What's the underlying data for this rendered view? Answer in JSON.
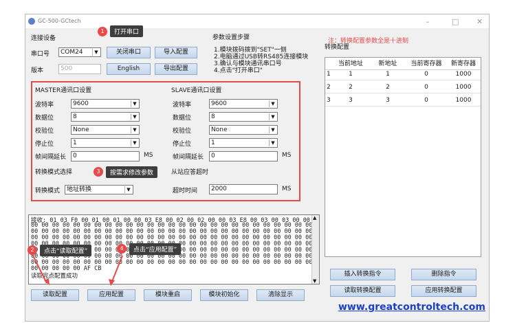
{
  "window": {
    "title": "GC-500-GCtech",
    "min": "–",
    "max": "□",
    "close": "✕"
  },
  "connect": {
    "section_label": "连接设备",
    "port_label": "串口号",
    "port_value": "COM24",
    "close_port": "关闭串口",
    "import_cfg": "导入配置",
    "version_label": "版本",
    "version_value": "500",
    "language": "English",
    "export_cfg": "导出配置"
  },
  "steps": {
    "title": "参数设置步骤",
    "items": [
      "1.模块拨码拨到\"SET\"一侧",
      "2.电脑通过USB转RS485连接模块",
      "3.确认与模块通讯串口号",
      "4.点击\"打开串口\""
    ]
  },
  "note": {
    "text": "注：转换配置参数全是十进制",
    "color": "#e74a4a"
  },
  "master": {
    "title": "MASTER通讯口设置",
    "baud_label": "波特率",
    "baud": "9600",
    "data_label": "数据位",
    "data": "8",
    "parity_label": "校验位",
    "parity": "None",
    "stop_label": "停止位",
    "stop": "1",
    "gap_label": "帧间隔延长",
    "gap": "0",
    "gap_unit": "MS"
  },
  "slave": {
    "title": "SLAVE通讯口设置",
    "baud_label": "波特率",
    "baud": "9600",
    "data_label": "数据位",
    "data": "8",
    "parity_label": "校验位",
    "parity": "None",
    "stop_label": "停止位",
    "stop": "1",
    "gap_label": "帧间隔延长",
    "gap": "0",
    "gap_unit": "MS"
  },
  "mode": {
    "select_title": "转换模式选择",
    "mode_label": "转换模式",
    "mode_value": "地址转换",
    "timeout_title": "从站应答超时",
    "timeout_label": "超时时间",
    "timeout_value": "2000",
    "timeout_unit": "MS"
  },
  "table": {
    "title": "转换配置",
    "headers": [
      "当前地址",
      "新地址",
      "当前寄存器",
      "新寄存器"
    ],
    "rows": [
      {
        "n": "1",
        "cur_addr": "1",
        "new_addr": "1",
        "cur_reg": "0",
        "new_reg": "1000"
      },
      {
        "n": "2",
        "cur_addr": "2",
        "new_addr": "2",
        "cur_reg": "0",
        "new_reg": "1000"
      },
      {
        "n": "3",
        "cur_addr": "3",
        "new_addr": "3",
        "cur_reg": "0",
        "new_reg": "1000"
      }
    ]
  },
  "log": {
    "lines": [
      "接收: 01 03 F0 00 01 00 01 00 00 03 E8 00 02 00 02 00 00 03 E8 00 03 00 03 00 00 03 E8 00",
      "00 00 00 00 00 00 00 00 00 00 00 00 00 00 00 00 00 00 00 00 00 00 00 00 00 00 00 00 00 00",
      "00 00 00 00 00 00 00 00 00 00 00 00 00 00 00 00 00 00 00 00 00 00 00 00 00 00 00 00 00 00",
      "00 00 00 00 00 00 00 00 00 00 00 00 00 00 00 00 00 00 00 00 00 00 00 00 00 00 00 00 00 00",
      "00 00 00 00 00 00 00 00 00 00 00 00 00 00 00 00 00 00 00 00 00 00 00 00 00 00 00 00 00 00",
      "00 00 00 00 00 00 00 00 00 00 00 00 00 00 00 00 00 00 00 00 00 00 00 00 00 00 00 00 00 00",
      "00 00 00 00 00 00 00 00 00 00 00 00 00 00 00 00 00 00 00 00 00 00 00 00 00 00 00 00 00 00",
      "00 00 00 00 00 00 00 00 00 00 00 00 00 00 00 00 00 00 00 00 00 00 00 00 00 00 00 00 00 00",
      "00 00 00 00 00 AF CB",
      "读取完点配置成功"
    ]
  },
  "bottom_buttons": [
    "读取配置",
    "应用配置",
    "模块重启",
    "模块初始化",
    "清除显示"
  ],
  "right_buttons": {
    "insert": "插入转换指令",
    "delete": "删除指令",
    "read": "读取转换配置",
    "apply": "应用转换配置"
  },
  "annotations": {
    "a1": {
      "num": "1",
      "text": "打开串口"
    },
    "a2": {
      "num": "2",
      "text": "点击“读取配置”"
    },
    "a3": {
      "num": "3",
      "text": "按需求修改参数"
    },
    "a4": {
      "num": "4",
      "text": "点击“应用配置”"
    }
  },
  "website": "www.greatcontroltech.com"
}
